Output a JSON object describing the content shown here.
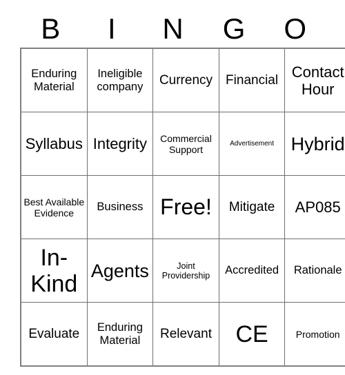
{
  "card": {
    "header_letters": [
      "B",
      "I",
      "N",
      "G",
      "O"
    ],
    "free_space_label": "Free!",
    "grid_line_color": "#6e6e6e",
    "border_color": "#7f7f7f",
    "text_color": "#000000",
    "background_color": "#ffffff",
    "rows": [
      [
        {
          "text": "Enduring Material",
          "size": "md"
        },
        {
          "text": "Ineligible company",
          "size": "md"
        },
        {
          "text": "Currency",
          "size": "lg"
        },
        {
          "text": "Financial",
          "size": "lg"
        },
        {
          "text": "Contact Hour",
          "size": "xl"
        }
      ],
      [
        {
          "text": "Syllabus",
          "size": "xl"
        },
        {
          "text": "Integrity",
          "size": "xl"
        },
        {
          "text": "Commercial Support",
          "size": "smd"
        },
        {
          "text": "Advertisement",
          "size": "xs"
        },
        {
          "text": "Hybrid",
          "size": "2xl"
        }
      ],
      [
        {
          "text": "Best Available Evidence",
          "size": "smd"
        },
        {
          "text": "Business",
          "size": "md"
        },
        {
          "text": "Free!",
          "size": "3xl"
        },
        {
          "text": "Mitigate",
          "size": "lg"
        },
        {
          "text": "AP085",
          "size": "xl"
        }
      ],
      [
        {
          "text": "In-Kind",
          "size": "4xl"
        },
        {
          "text": "Agents",
          "size": "2xl"
        },
        {
          "text": "Joint Providership",
          "size": "sm"
        },
        {
          "text": "Accredited",
          "size": "md"
        },
        {
          "text": "Rationale",
          "size": "md"
        }
      ],
      [
        {
          "text": "Evaluate",
          "size": "lg"
        },
        {
          "text": "Enduring Material",
          "size": "md"
        },
        {
          "text": "Relevant",
          "size": "lg"
        },
        {
          "text": "CE",
          "size": "4xl"
        },
        {
          "text": "Promotion",
          "size": "smd"
        }
      ]
    ]
  }
}
